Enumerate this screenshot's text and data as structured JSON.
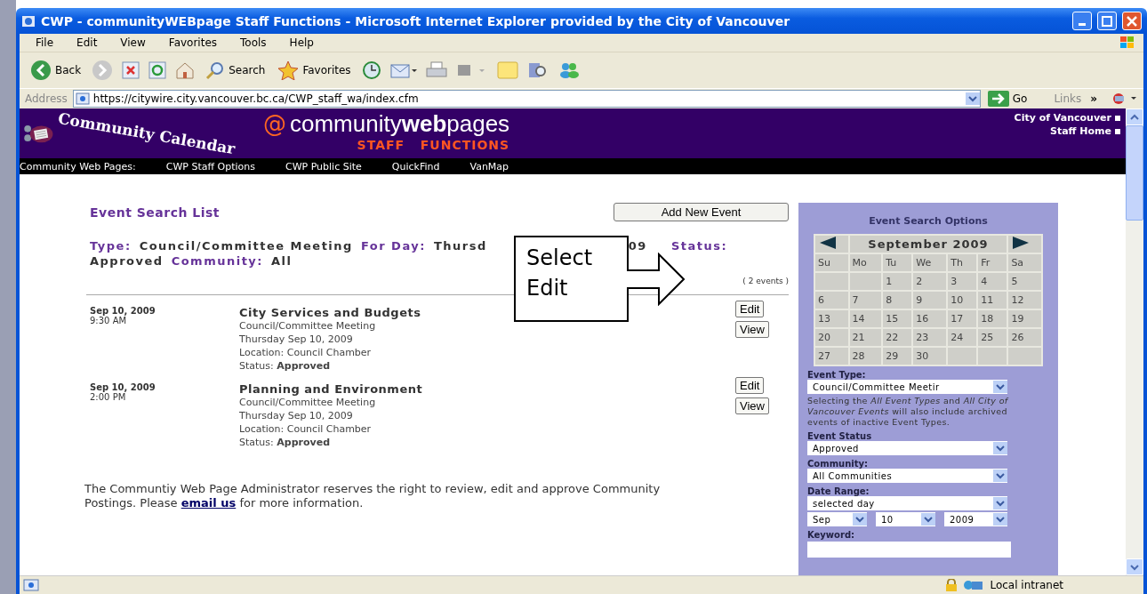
{
  "window": {
    "title": "CWP - communityWEBpage Staff Functions - Microsoft Internet Explorer provided by the City of Vancouver"
  },
  "menu": [
    "File",
    "Edit",
    "View",
    "Favorites",
    "Tools",
    "Help"
  ],
  "toolbar": {
    "back": "Back",
    "search": "Search",
    "favorites": "Favorites"
  },
  "address": {
    "label": "Address",
    "url": "https://citywire.city.vancouver.bc.ca/CWP_staff_wa/index.cfm",
    "go": "Go",
    "links": "Links",
    "more": "»"
  },
  "banner": {
    "logo_text": "Community Calendar",
    "at": "@",
    "site": "community**web**pages",
    "subtitle": "STAFF   FUNCTIONS",
    "links": [
      "City of Vancouver",
      "Staff Home"
    ]
  },
  "nav": [
    "Community Web Pages:",
    "CWP Staff Options",
    "CWP Public Site",
    "QuickFind",
    "VanMap"
  ],
  "content": {
    "heading": "Event Search List",
    "add_button": "Add New Event",
    "criteria": [
      [
        {
          "kind": "label",
          "text": "Type:"
        },
        {
          "kind": "value",
          "text": "Council/Committee Meeting"
        },
        {
          "kind": "label",
          "text": "For Day:"
        },
        {
          "kind": "value",
          "text": "Thursd"
        },
        {
          "kind": "covered",
          "text": "09"
        },
        {
          "kind": "label",
          "text": "Status:"
        }
      ],
      [
        {
          "kind": "value",
          "text": "Approved"
        },
        {
          "kind": "label",
          "text": "Community:"
        },
        {
          "kind": "value",
          "text": "All"
        }
      ]
    ],
    "count": "( 2 events )",
    "callout": "Select Edit",
    "events": [
      {
        "date": "Sep 10, 2009",
        "time": "9:30 AM",
        "title": "City Services and Budgets",
        "details": [
          "Council/Committee Meeting",
          "Thursday Sep 10, 2009",
          "Location: Council Chamber",
          "Status: **Approved**"
        ],
        "buttons": [
          "Edit",
          "View"
        ]
      },
      {
        "date": "Sep 10, 2009",
        "time": "2:00 PM",
        "title": "Planning and Environment",
        "details": [
          "Council/Committee Meeting",
          "Thursday Sep 10, 2009",
          "Location: Council Chamber",
          "Status: **Approved**"
        ],
        "buttons": [
          "Edit",
          "View"
        ]
      }
    ],
    "footer": {
      "before": "The Communtiy Web Page Administrator reserves the right to review, edit and approve Community Postings. Please",
      "link": "email us",
      "after": "for more information."
    }
  },
  "sidebar": {
    "title": "Event Search Options",
    "calendar": {
      "month": "September 2009",
      "weekdays": [
        "Su",
        "Mo",
        "Tu",
        "We",
        "Th",
        "Fr",
        "Sa"
      ],
      "weeks": [
        [
          {
            "kind": "blank"
          },
          {
            "kind": "blank"
          },
          {
            "kind": "day",
            "day": "1"
          },
          {
            "kind": "day",
            "day": "2"
          },
          {
            "kind": "day",
            "day": "3"
          },
          {
            "kind": "day",
            "day": "4"
          },
          {
            "kind": "day",
            "day": "5"
          }
        ],
        [
          {
            "kind": "day",
            "day": "6"
          },
          {
            "kind": "day",
            "day": "7"
          },
          {
            "kind": "day",
            "day": "8"
          },
          {
            "kind": "day",
            "day": "9"
          },
          {
            "kind": "day",
            "day": "10"
          },
          {
            "kind": "day",
            "day": "11"
          },
          {
            "kind": "day",
            "day": "12"
          }
        ],
        [
          {
            "kind": "day",
            "day": "13"
          },
          {
            "kind": "day",
            "day": "14"
          },
          {
            "kind": "day",
            "day": "15"
          },
          {
            "kind": "day",
            "day": "16"
          },
          {
            "kind": "day",
            "day": "17"
          },
          {
            "kind": "day",
            "day": "18"
          },
          {
            "kind": "day",
            "day": "19"
          }
        ],
        [
          {
            "kind": "day",
            "day": "20"
          },
          {
            "kind": "day",
            "day": "21"
          },
          {
            "kind": "day",
            "day": "22"
          },
          {
            "kind": "day",
            "day": "23"
          },
          {
            "kind": "day",
            "day": "24"
          },
          {
            "kind": "day",
            "day": "25"
          },
          {
            "kind": "day",
            "day": "26"
          }
        ],
        [
          {
            "kind": "day",
            "day": "27"
          },
          {
            "kind": "day",
            "day": "28"
          },
          {
            "kind": "day",
            "day": "29"
          },
          {
            "kind": "day",
            "day": "30"
          },
          {
            "kind": "blank"
          },
          {
            "kind": "blank"
          },
          {
            "kind": "blank"
          }
        ]
      ]
    },
    "event_type": {
      "label": "Event Type:",
      "value": "Council/Committee Meetir"
    },
    "help": "Selecting the *All Event Types* and *All City of Vancouver Events* will also include archived events of inactive Event Types.",
    "event_status": {
      "label": "Event Status",
      "value": "Approved"
    },
    "community": {
      "label": "Community:",
      "value": "All Communities"
    },
    "date_range": {
      "label": "Date Range:",
      "value": "selected day"
    },
    "date": [
      "Sep",
      "10",
      "2009"
    ],
    "keyword": {
      "label": "Keyword:"
    }
  },
  "status_bar": {
    "zone": "Local intranet"
  }
}
